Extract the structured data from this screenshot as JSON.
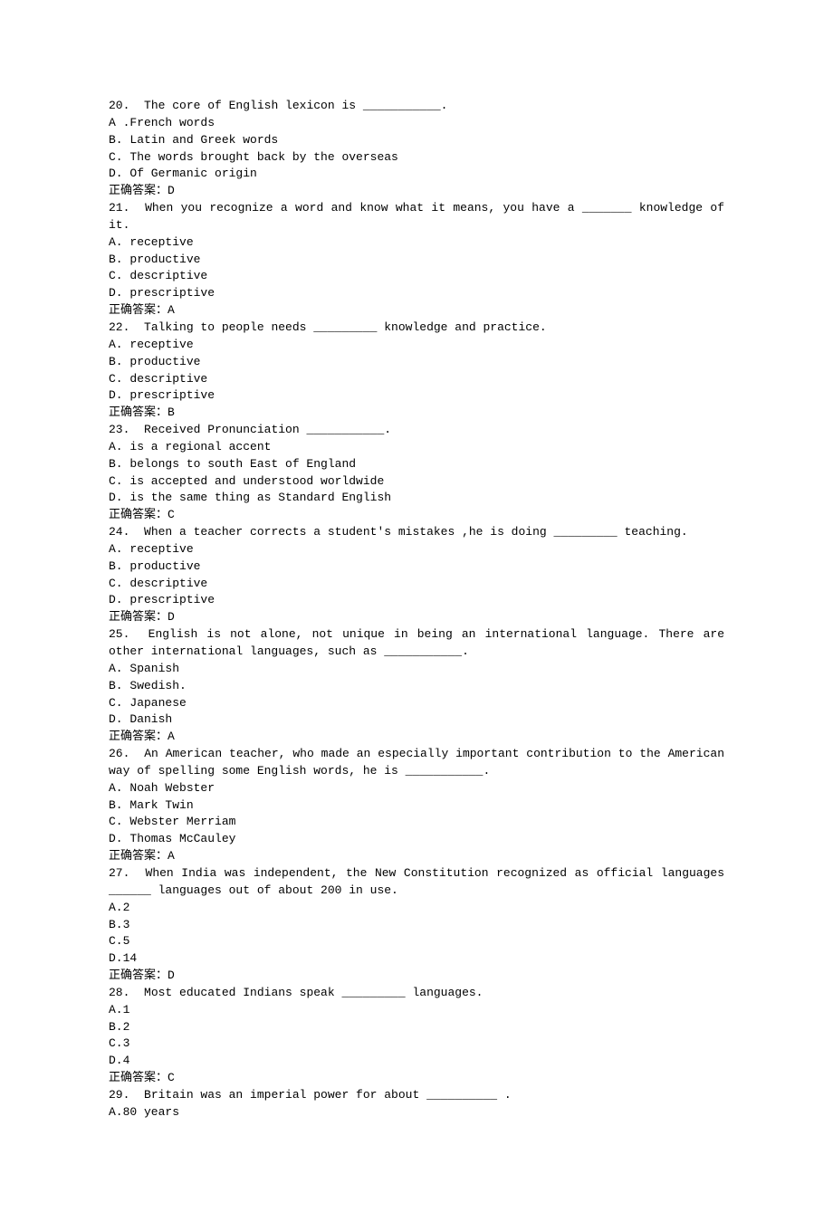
{
  "questions": [
    {
      "number": "20.",
      "text": "The core of English lexicon is ___________.",
      "options": [
        "A .French words",
        "B. Latin and Greek words",
        "C. The words brought back by the overseas",
        "D. Of Germanic origin"
      ],
      "answer": "正确答案：D"
    },
    {
      "number": "21.",
      "text": "When you recognize a word and know what it means, you have a _______ knowledge of it.",
      "options": [
        "A. receptive",
        "B. productive",
        "C. descriptive",
        "D. prescriptive"
      ],
      "answer": "正确答案：A"
    },
    {
      "number": "22.",
      "text": "Talking to people needs _________ knowledge and practice.",
      "options": [
        "A. receptive",
        "B. productive",
        "C. descriptive",
        "D. prescriptive"
      ],
      "answer": "正确答案：B"
    },
    {
      "number": "23.",
      "text": "Received Pronunciation ___________.",
      "options": [
        "A. is a regional accent",
        "B. belongs to south East of England",
        "C. is accepted and understood worldwide",
        "D. is the same thing as Standard English"
      ],
      "answer": "正确答案：C"
    },
    {
      "number": "24.",
      "text": "When a teacher corrects a student's mistakes ,he is doing _________ teaching.",
      "options": [
        "A. receptive",
        "B. productive",
        "C. descriptive",
        "D. prescriptive"
      ],
      "answer": "正确答案：D"
    },
    {
      "number": "25.",
      "text": "English is not alone, not unique in being an international language. There are other international languages, such as ___________.",
      "options": [
        "A. Spanish",
        "B. Swedish.",
        "C. Japanese",
        "D. Danish"
      ],
      "answer": "正确答案：A"
    },
    {
      "number": "26.",
      "text": "An American teacher, who made an especially important contribution to the American way of spelling some English words, he is ___________.",
      "options": [
        "A. Noah Webster",
        "B. Mark Twin",
        "C. Webster Merriam",
        "D. Thomas McCauley"
      ],
      "answer": "正确答案：A"
    },
    {
      "number": "27.",
      "text": "When India was independent, the New Constitution recognized as official languages ______ languages out of about 200 in use.",
      "options": [
        "A.2",
        "B.3",
        "C.5",
        "D.14"
      ],
      "answer": "正确答案：D"
    },
    {
      "number": "28.",
      "text": "Most educated Indians speak _________ languages.",
      "options": [
        "A.1",
        "B.2",
        "C.3",
        "D.4"
      ],
      "answer": "正确答案：C"
    },
    {
      "number": "29.",
      "text": "Britain was an imperial power for about __________ .",
      "options": [
        "A.80 years"
      ],
      "answer": ""
    }
  ]
}
